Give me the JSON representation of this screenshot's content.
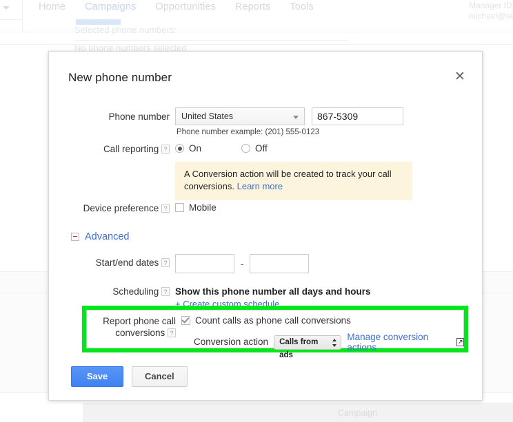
{
  "background": {
    "nav_items": [
      {
        "label": "Home",
        "active": false
      },
      {
        "label": "Campaigns",
        "active": true
      },
      {
        "label": "Opportunities",
        "active": false
      },
      {
        "label": "Reports",
        "active": false
      },
      {
        "label": "Tools",
        "active": false
      }
    ],
    "manager_id_line1": "Manager ID:",
    "manager_id_line2": "michael@se",
    "selected_phone_numbers_label": "Selected phone numbers:",
    "no_phone_numbers_text": "No phone numbers selected",
    "footer_column_label": "Campaign"
  },
  "dialog": {
    "title": "New phone number",
    "close_label": "✕",
    "phone_number": {
      "label": "Phone number",
      "country_value": "United States",
      "country_options": [
        "United States"
      ],
      "number_value": "867-5309",
      "number_placeholder": "",
      "hint": "Phone number example: (201) 555-0123"
    },
    "call_reporting": {
      "label": "Call reporting",
      "help": "?",
      "options": [
        {
          "label": "On",
          "selected": true
        },
        {
          "label": "Off",
          "selected": false
        }
      ],
      "info_text": "A Conversion action will be created to track your call conversions.",
      "info_link": "Learn more"
    },
    "device_preference": {
      "label": "Device preference",
      "help": "?",
      "checkbox_label": "Mobile",
      "checked": false
    },
    "advanced": {
      "label": "Advanced",
      "expanded": true
    },
    "start_end_dates": {
      "label": "Start/end dates",
      "help": "?",
      "start_value": "",
      "end_value": "",
      "separator": "-"
    },
    "scheduling": {
      "label": "Scheduling",
      "help": "?",
      "summary": "Show this phone number all days and hours",
      "custom_link": "+ Create custom schedule"
    },
    "report_conversions": {
      "label_line1": "Report phone call",
      "label_line2": "conversions",
      "help": "?",
      "count_checkbox_label": "Count calls as phone call conversions",
      "count_checked": true,
      "conversion_action_label": "Conversion action",
      "conversion_action_value": "Calls from ads",
      "conversion_action_options": [
        "Calls from ads"
      ],
      "manage_link": "Manage conversion actions",
      "highlight_color": "#00e81b"
    },
    "buttons": {
      "save": "Save",
      "cancel": "Cancel",
      "save_color": "#4b8df8"
    }
  }
}
